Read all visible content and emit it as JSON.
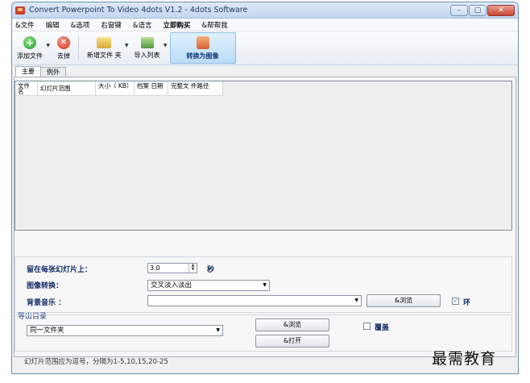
{
  "window": {
    "title": "Convert Powerpoint To Video 4dots V1.2 - 4dots Software",
    "buttons": {
      "minimize": "–",
      "maximize": "▢",
      "close": "✕"
    }
  },
  "menu": [
    "&文件",
    "编辑",
    "&选项",
    "右窗键",
    "&语言",
    "立即购买",
    "&帮帮我"
  ],
  "toolbar": {
    "add_file": "添加文件",
    "remove": "去掉",
    "new_folder": "新增文件 夹",
    "import_list": "导入列表",
    "convert": "转换为图像"
  },
  "tabs": [
    "主要",
    "例外"
  ],
  "grid": {
    "columns": [
      "文件 名",
      "幻灯片范围",
      "大小（ KB）",
      "档案 日期",
      "完整文 件路径"
    ]
  },
  "settings": {
    "duration_label": "留在每张幻灯片上：",
    "duration_value": "3.0",
    "duration_unit": "秒",
    "transition_label": "图像转换：",
    "transition_value": "交叉淡入淡出",
    "music_label": "背景音乐 ：",
    "music_value": "",
    "browse_music": "&浏览",
    "loop_label": "环",
    "loop_checked": true
  },
  "output": {
    "group_label": "导出目录",
    "folder_value": "同一文件夹",
    "browse": "&浏览",
    "open": "&打开",
    "overwrite_label": "覆盖",
    "overwrite_checked": false
  },
  "hint": "幻灯片范围应为逗号，分隔为1-5,10,15,20-25",
  "watermark": "最需教育"
}
